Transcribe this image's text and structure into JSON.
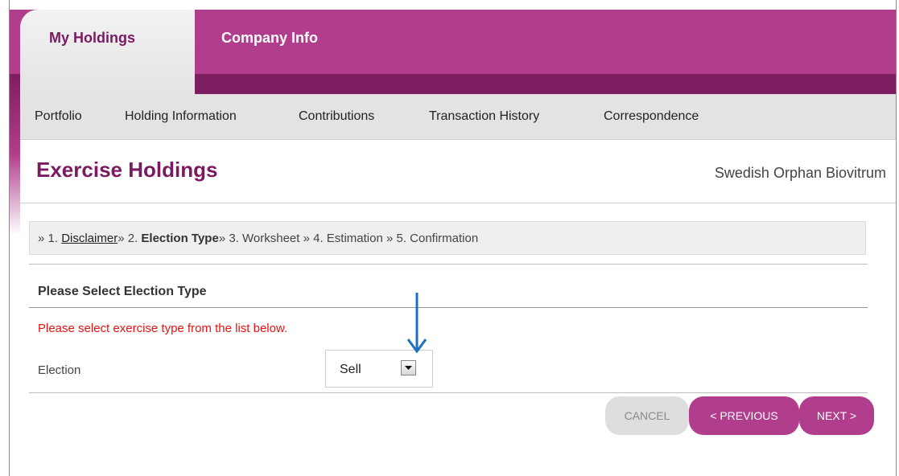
{
  "colors": {
    "brand": "#b03e8c",
    "brand_dark": "#7d1e60",
    "title": "#7a1a61",
    "warning": "#ee1111"
  },
  "top_tabs": {
    "active": "My Holdings",
    "other": "Company Info"
  },
  "subnav": [
    "Portfolio",
    "Holding Information",
    "Contributions",
    "Transaction History",
    "Correspondence"
  ],
  "page": {
    "title": "Exercise Holdings",
    "company": "Swedish Orphan Biovitrum"
  },
  "steps": {
    "prefix": "» 1. ",
    "step1": "Disclaimer",
    "sep2": "» 2. ",
    "step2": "Election Type",
    "rest": "» 3. Worksheet » 4. Estimation » 5. Confirmation"
  },
  "section": {
    "title": "Please Select Election Type",
    "warning": "Please select exercise type from the list below."
  },
  "election": {
    "label": "Election",
    "value": "Sell"
  },
  "buttons": {
    "cancel": "CANCEL",
    "previous": "< PREVIOUS",
    "next": "NEXT >"
  }
}
